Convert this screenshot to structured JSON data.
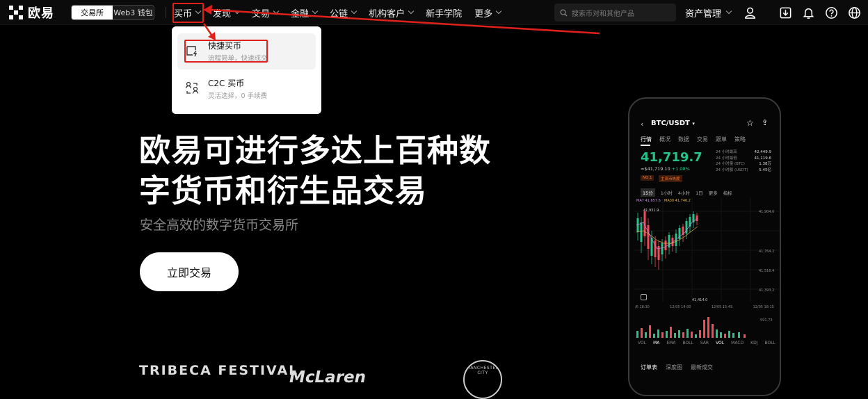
{
  "brand": {
    "name": "欧易"
  },
  "mode_switch": {
    "exchange": "交易所",
    "web3": "Web3 钱包"
  },
  "nav": [
    {
      "label": "买币"
    },
    {
      "label": "发现"
    },
    {
      "label": "交易"
    },
    {
      "label": "金融"
    },
    {
      "label": "公链"
    },
    {
      "label": "机构客户"
    },
    {
      "label": "新手学院"
    },
    {
      "label": "更多"
    }
  ],
  "search": {
    "placeholder": "搜索币对和其他产品"
  },
  "assets": {
    "label": "资产管理"
  },
  "icons": [
    "user-icon",
    "download-icon",
    "bell-icon",
    "help-icon",
    "globe-icon"
  ],
  "dropdown": {
    "items": [
      {
        "title": "快捷买币",
        "subtitle": "流程简单，快速成交"
      },
      {
        "title": "C2C 买币",
        "subtitle": "灵活选择，0 手续费"
      }
    ]
  },
  "annotation": {
    "color": "#e0211b"
  },
  "hero": {
    "title_line1": "欧易可进行多达上百种数",
    "title_line2": "字货币和衍生品交易",
    "subtitle": "安全高效的数字货币交易所",
    "cta": "立即交易"
  },
  "partners": [
    "TRIBECA FESTIVAL",
    "McLaren",
    "MANCHESTER CITY"
  ],
  "phone": {
    "pair": "BTC/USDT",
    "tabs": [
      "行情",
      "概况",
      "数据",
      "交易",
      "跟单",
      "策略"
    ],
    "price": "41,719.7",
    "price_fiat": "≈$41,719.10",
    "change": "+1.08%",
    "badge_1": "NO.1",
    "badge_2": "主流币热度",
    "stats": [
      {
        "label": "24 小时最高",
        "value": "42,449.9"
      },
      {
        "label": "24 小时最低",
        "value": "41,119.6"
      },
      {
        "label": "24 小时量 (BTC)",
        "value": "1.38万"
      },
      {
        "label": "24 小时额 (USDT)",
        "value": "5.45亿"
      }
    ],
    "intervals": [
      "15分",
      "1小时",
      "4小时",
      "1日",
      "更多",
      "指标"
    ],
    "ma_labels": [
      "MA7 41,657.6",
      "MA30 41,746.2"
    ],
    "price_axis": [
      "41,904.6",
      "41,764.2",
      "41,516.4",
      "41,393.2"
    ],
    "high_marker": "41,931.9",
    "low_marker": "41,414.0",
    "time_axis": [
      "/6 18:30",
      "12/05 14:00",
      "12/05 15:45",
      "12/05 18:15"
    ],
    "vol_value": "591.73",
    "indicators": [
      "VOL",
      "MA",
      "EMA",
      "BOLL",
      "SAR",
      "VOL",
      "MACD",
      "KDJ",
      "BOLL"
    ],
    "bottom_tabs": [
      "订单表",
      "深度图",
      "最新成交"
    ]
  }
}
